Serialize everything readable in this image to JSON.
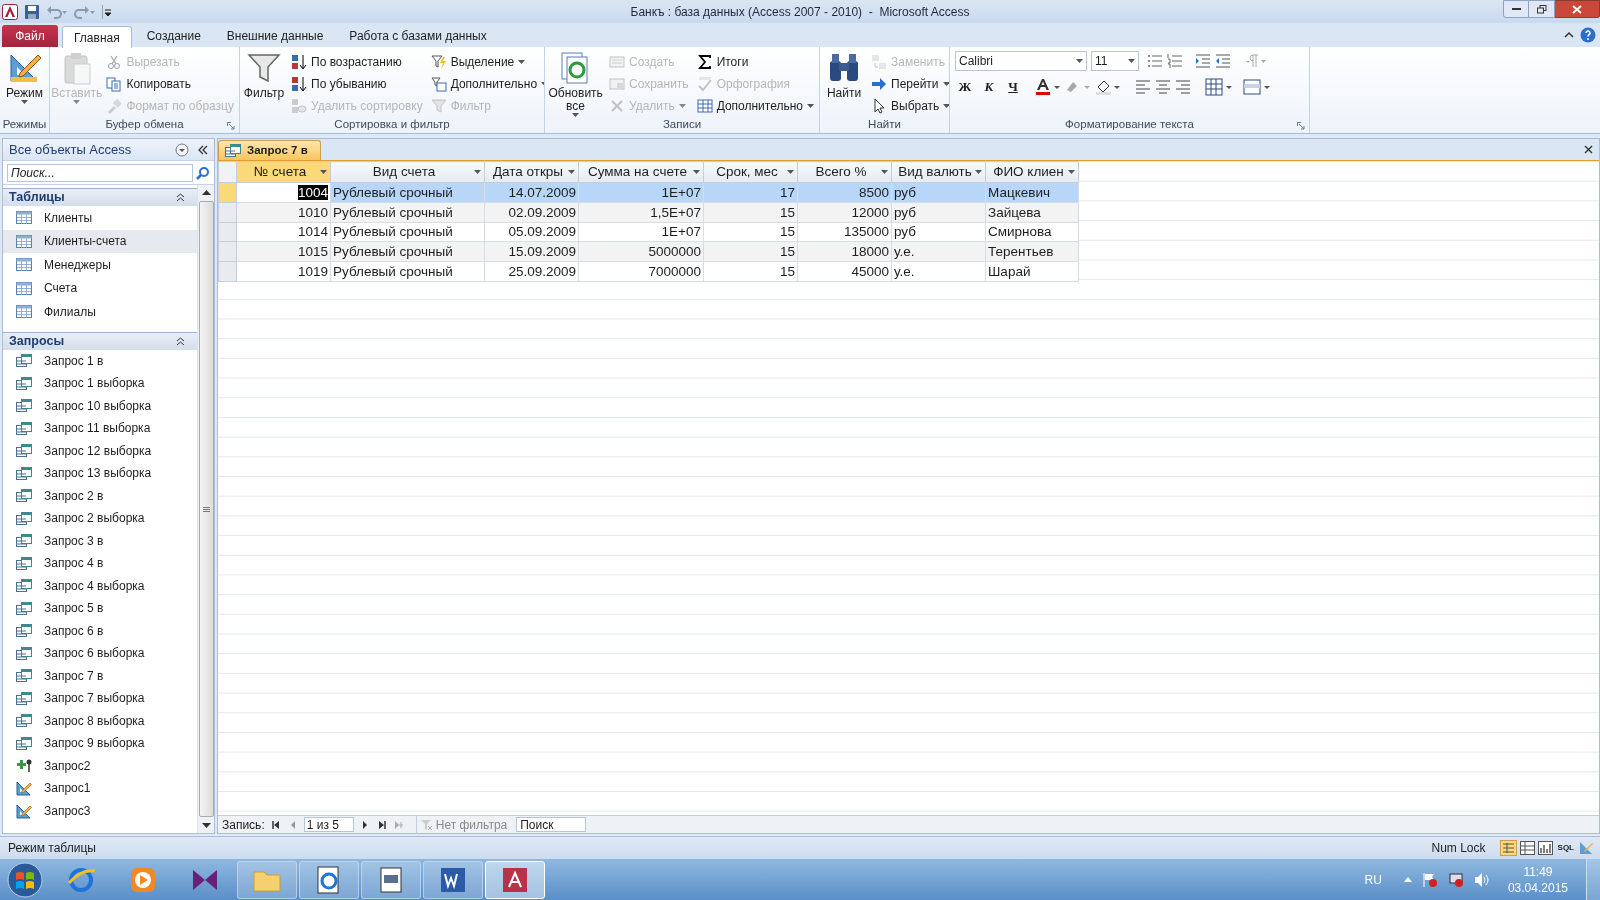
{
  "window": {
    "title": "Банкъ : база данных (Access 2007 - 2010)  -  Microsoft Access"
  },
  "ribbon_tabs": [
    {
      "label": "Файл",
      "kind": "file",
      "selected": false
    },
    {
      "label": "Главная",
      "kind": "tab",
      "selected": true
    },
    {
      "label": "Создание",
      "kind": "tab",
      "selected": false
    },
    {
      "label": "Внешние данные",
      "kind": "tab",
      "selected": false
    },
    {
      "label": "Работа с базами данных",
      "kind": "tab",
      "selected": false
    }
  ],
  "ribbon_groups": [
    {
      "label": "Режимы",
      "kind": "commands",
      "launcher": false,
      "items": [
        {
          "kind": "large",
          "label": "Режим",
          "dropdown": true,
          "disabled": false
        }
      ]
    },
    {
      "label": "Буфер обмена",
      "kind": "commands",
      "launcher": true,
      "items": [
        {
          "kind": "large",
          "label": "Вставить",
          "dropdown": true,
          "disabled": true
        },
        {
          "kind": "small",
          "label": "Вырезать",
          "dropdown": false,
          "disabled": true
        },
        {
          "kind": "small",
          "label": "Копировать",
          "dropdown": false,
          "disabled": false
        },
        {
          "kind": "small",
          "label": "Формат по образцу",
          "dropdown": false,
          "disabled": true
        }
      ]
    },
    {
      "label": "Сортировка и фильтр",
      "kind": "commands",
      "launcher": false,
      "items": [
        {
          "kind": "large",
          "label": "Фильтр",
          "dropdown": false,
          "disabled": false
        },
        {
          "kind": "small",
          "label": "По возрастанию",
          "dropdown": false,
          "disabled": false
        },
        {
          "kind": "small",
          "label": "По убыванию",
          "dropdown": false,
          "disabled": false
        },
        {
          "kind": "small",
          "label": "Удалить сортировку",
          "dropdown": false,
          "disabled": true
        },
        {
          "kind": "small",
          "label": "Выделение",
          "dropdown": true,
          "disabled": false
        },
        {
          "kind": "small",
          "label": "Дополнительно",
          "dropdown": true,
          "disabled": false
        },
        {
          "kind": "small",
          "label": "Фильтр",
          "dropdown": false,
          "disabled": true
        }
      ]
    },
    {
      "label": "Записи",
      "kind": "commands",
      "launcher": false,
      "items": [
        {
          "kind": "large",
          "label": "Обновить все",
          "dropdown": true,
          "disabled": false
        },
        {
          "kind": "small",
          "label": "Создать",
          "dropdown": false,
          "disabled": true
        },
        {
          "kind": "small",
          "label": "Сохранить",
          "dropdown": false,
          "disabled": true
        },
        {
          "kind": "small",
          "label": "Удалить",
          "dropdown": true,
          "disabled": true
        },
        {
          "kind": "small",
          "label": "Итоги",
          "dropdown": false,
          "disabled": false
        },
        {
          "kind": "small",
          "label": "Орфография",
          "dropdown": false,
          "disabled": true
        },
        {
          "kind": "small",
          "label": "Дополнительно",
          "dropdown": true,
          "disabled": false
        }
      ]
    },
    {
      "label": "Найти",
      "kind": "commands",
      "launcher": false,
      "items": [
        {
          "kind": "large",
          "label": "Найти",
          "dropdown": false,
          "disabled": false
        },
        {
          "kind": "small",
          "label": "Заменить",
          "dropdown": false,
          "disabled": true
        },
        {
          "kind": "small",
          "label": "Перейти",
          "dropdown": true,
          "disabled": false
        },
        {
          "kind": "small",
          "label": "Выбрать",
          "dropdown": true,
          "disabled": false
        }
      ]
    },
    {
      "label": "Форматирование текста",
      "kind": "text_format",
      "launcher": true,
      "font": "Calibri",
      "size": "11",
      "styles": [
        "Ж",
        "К",
        "Ч"
      ]
    }
  ],
  "navigation": {
    "title": "Все объекты Access",
    "search": {
      "placeholder": "Поиск..."
    },
    "sections": [
      {
        "label": "Таблицы",
        "expanded": true,
        "items": [
          {
            "label": "Клиенты",
            "kind": "table",
            "selected": false
          },
          {
            "label": "Клиенты-счета",
            "kind": "table",
            "selected": true
          },
          {
            "label": "Менеджеры",
            "kind": "table",
            "selected": false
          },
          {
            "label": "Счета",
            "kind": "table",
            "selected": false
          },
          {
            "label": "Филиалы",
            "kind": "table",
            "selected": false
          }
        ]
      },
      {
        "label": "Запросы",
        "expanded": true,
        "items": [
          {
            "label": "Запрос 1 в",
            "kind": "select",
            "selected": false
          },
          {
            "label": "Запрос 1 выборка",
            "kind": "select",
            "selected": false
          },
          {
            "label": "Запрос 10 выборка",
            "kind": "select",
            "selected": false
          },
          {
            "label": "Запрос 11 выборка",
            "kind": "select",
            "selected": false
          },
          {
            "label": "Запрос 12 выборка",
            "kind": "select",
            "selected": false
          },
          {
            "label": "Запрос 13 выборка",
            "kind": "select",
            "selected": false
          },
          {
            "label": "Запрос 2 в",
            "kind": "select",
            "selected": false
          },
          {
            "label": "Запрос 2 выборка",
            "kind": "select",
            "selected": false
          },
          {
            "label": "Запрос 3 в",
            "kind": "select",
            "selected": false
          },
          {
            "label": "Запрос 4 в",
            "kind": "select",
            "selected": false
          },
          {
            "label": "Запрос 4 выборка",
            "kind": "select",
            "selected": false
          },
          {
            "label": "Запрос 5 в",
            "kind": "select",
            "selected": false
          },
          {
            "label": "Запрос 6 в",
            "kind": "select",
            "selected": false
          },
          {
            "label": "Запрос 6 выборка",
            "kind": "select",
            "selected": false
          },
          {
            "label": "Запрос 7 в",
            "kind": "select",
            "selected": false
          },
          {
            "label": "Запрос 7 выборка",
            "kind": "select",
            "selected": false
          },
          {
            "label": "Запрос 8 выборка",
            "kind": "select",
            "selected": false
          },
          {
            "label": "Запрос 9 выборка",
            "kind": "select",
            "selected": false
          },
          {
            "label": "Запрос2",
            "kind": "append",
            "selected": false
          },
          {
            "label": "Запрос1",
            "kind": "update",
            "selected": false
          },
          {
            "label": "Запрос3",
            "kind": "update",
            "selected": false
          }
        ]
      }
    ]
  },
  "document_tab": {
    "label": "Запрос 7 в"
  },
  "table": {
    "columns": [
      {
        "label": "№ счета",
        "selected": true
      },
      {
        "label": "Вид счета",
        "selected": false
      },
      {
        "label": "Дата откры",
        "selected": false
      },
      {
        "label": "Сумма на счете",
        "selected": false
      },
      {
        "label": "Срок, мес",
        "selected": false
      },
      {
        "label": "Всего %",
        "selected": false
      },
      {
        "label": "Вид валють",
        "selected": false
      },
      {
        "label": "ФИО клиен",
        "selected": false
      }
    ],
    "rows": [
      {
        "selected": true,
        "cells": [
          "1004",
          "Рублевый срочный",
          "14.07.2009",
          "1E+07",
          "17",
          "8500",
          "руб",
          "Мацкевич"
        ]
      },
      {
        "selected": false,
        "cells": [
          "1010",
          "Рублевый срочный",
          "02.09.2009",
          "1,5E+07",
          "15",
          "12000",
          "руб",
          "Зайцева"
        ]
      },
      {
        "selected": false,
        "cells": [
          "1014",
          "Рублевый срочный",
          "05.09.2009",
          "1E+07",
          "15",
          "135000",
          "руб",
          "Смирнова"
        ]
      },
      {
        "selected": false,
        "cells": [
          "1015",
          "Рублевый срочный",
          "15.09.2009",
          "5000000",
          "15",
          "18000",
          "у.е.",
          "Терентьев"
        ]
      },
      {
        "selected": false,
        "cells": [
          "1019",
          "Рублевый срочный",
          "25.09.2009",
          "7000000",
          "15",
          "45000",
          "у.е.",
          "Шарай"
        ]
      }
    ]
  },
  "record_navigator": {
    "label": "Запись:",
    "position": "1 из 5",
    "filter": "Нет фильтра",
    "search": {
      "placeholder": "Поиск"
    }
  },
  "status_bar": {
    "mode": "Режим таблицы",
    "num_lock": "Num Lock",
    "sql_view": "SQL"
  },
  "taskbar": {
    "language": "RU",
    "time": "11:49",
    "date": "03.04.2015"
  }
}
